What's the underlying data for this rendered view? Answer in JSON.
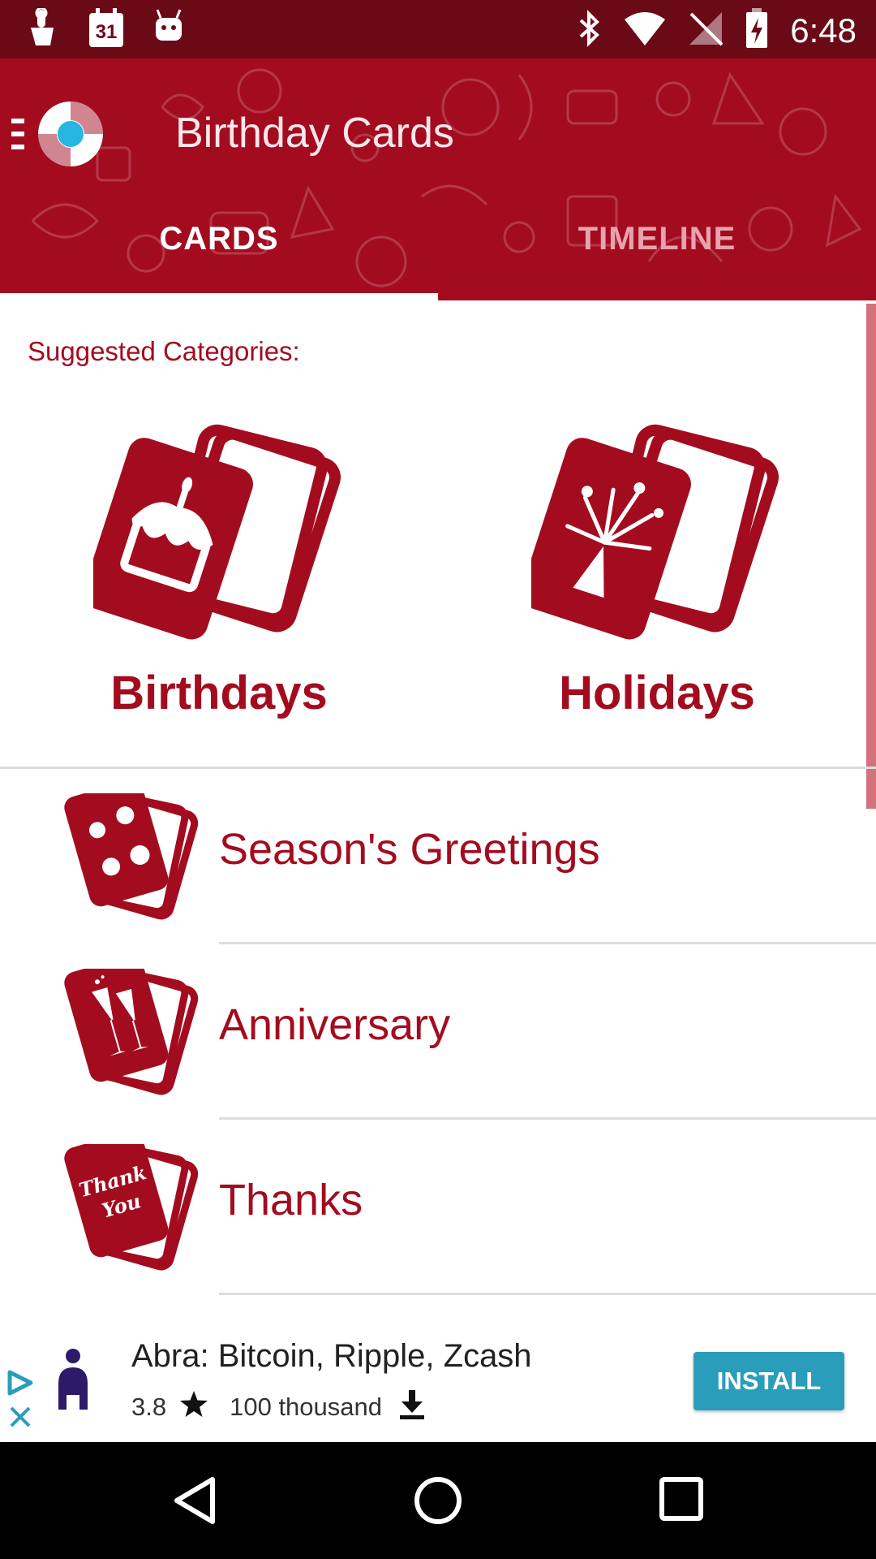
{
  "status_bar": {
    "time": "6:48",
    "left_icons": [
      "touch-icon",
      "calendar-icon",
      "android-icon"
    ],
    "calendar_day": "31",
    "right_icons": [
      "bluetooth-icon",
      "wifi-icon",
      "no-signal-icon",
      "battery-charging-icon"
    ]
  },
  "header": {
    "title": "Birthday Cards",
    "tabs": [
      {
        "label": "CARDS",
        "active": true
      },
      {
        "label": "TIMELINE",
        "active": false
      }
    ]
  },
  "content": {
    "suggested_label": "Suggested Categories:",
    "featured": [
      {
        "label": "Birthdays",
        "icon": "birthday-cake-card-icon"
      },
      {
        "label": "Holidays",
        "icon": "fireworks-card-icon"
      }
    ],
    "list": [
      {
        "label": "Season's Greetings",
        "icon": "seasons-card-icon"
      },
      {
        "label": "Anniversary",
        "icon": "champagne-glasses-card-icon"
      },
      {
        "label": "Thanks",
        "icon": "thank-you-card-icon",
        "card_text_1": "Thank",
        "card_text_2": "You"
      }
    ]
  },
  "ad": {
    "title": "Abra: Bitcoin, Ripple, Zcash",
    "rating": "3.8",
    "downloads": "100 thousand",
    "install_label": "INSTALL"
  },
  "colors": {
    "primary": "#a30c1f",
    "status_bar": "#6b0a17",
    "install": "#2a9dba"
  }
}
